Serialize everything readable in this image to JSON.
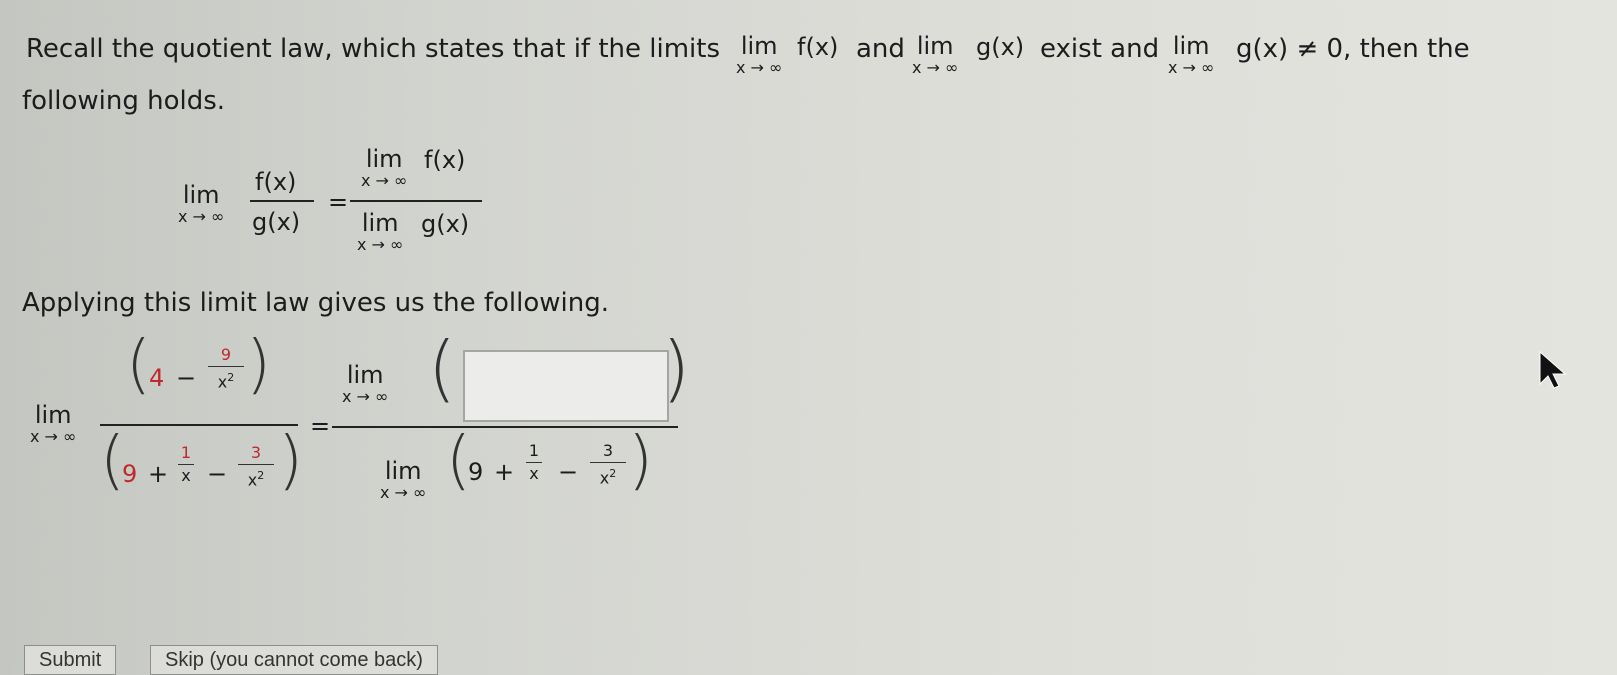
{
  "intro": {
    "part1": "Recall the quotient law, which states that if the limits",
    "f": "f(x)",
    "and": "and",
    "g": "g(x)",
    "exist_and": "exist and",
    "neq": "g(x) ≠ 0, then the",
    "line2": "following holds."
  },
  "lim": {
    "word": "lim",
    "sub": "x → ∞"
  },
  "law": {
    "num": "f(x)",
    "den": "g(x)",
    "eq": "=",
    "rhs_num": "f(x)",
    "rhs_den": "g(x)"
  },
  "applying": "Applying this limit law gives us the following.",
  "expr": {
    "four": "4",
    "minus": "−",
    "nine_num": "9",
    "x2": "x2",
    "nine": "9",
    "plus": "+",
    "one": "1",
    "x": "x",
    "three": "3",
    "eq": "="
  },
  "answer_input": {
    "value": ""
  },
  "buttons": {
    "submit": "Submit",
    "skip": "Skip (you cannot come back)"
  },
  "colors": {
    "highlight": "#c0292b"
  },
  "icons": {
    "cursor": "mouse-pointer-icon"
  }
}
